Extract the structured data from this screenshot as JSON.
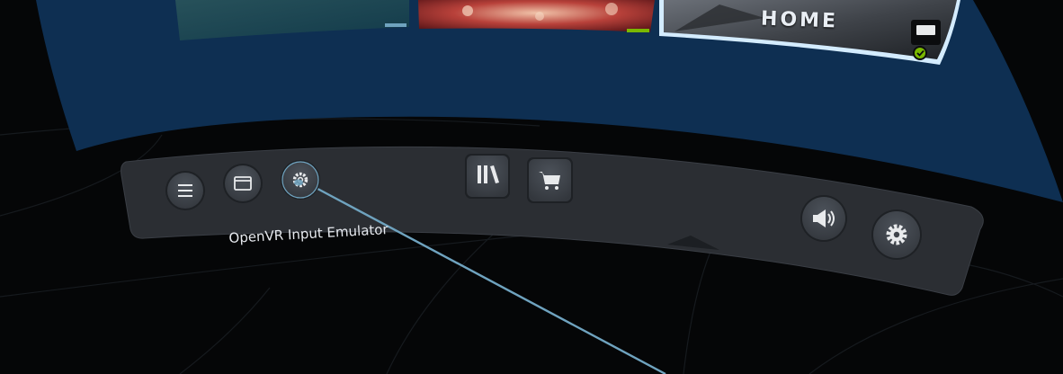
{
  "library": {
    "tiles": [
      {
        "id": "tile-left",
        "title": ""
      },
      {
        "id": "tile-middle",
        "title": ""
      },
      {
        "id": "tile-home",
        "title": "HOME",
        "selected": true
      }
    ]
  },
  "dashboard": {
    "left_buttons": [
      {
        "name": "menu-button",
        "icon": "hamburger-menu-icon"
      },
      {
        "name": "window-button",
        "icon": "window-icon"
      },
      {
        "name": "openvr-input-emulator-button",
        "icon": "gear-small-icon",
        "hovered": true
      }
    ],
    "center_buttons": [
      {
        "name": "library-button",
        "icon": "library-icon"
      },
      {
        "name": "store-button",
        "icon": "shopping-cart-icon"
      }
    ],
    "right_buttons": [
      {
        "name": "volume-button",
        "icon": "speaker-icon"
      },
      {
        "name": "settings-button",
        "icon": "gear-icon"
      }
    ],
    "tooltip": "OpenVR Input Emulator"
  },
  "colors": {
    "panel_blue": "#0e2f52",
    "bar": "#2b2e33",
    "button": "#3e434a",
    "pointer": "#6fa3bf",
    "accent_green": "#7ab800"
  }
}
